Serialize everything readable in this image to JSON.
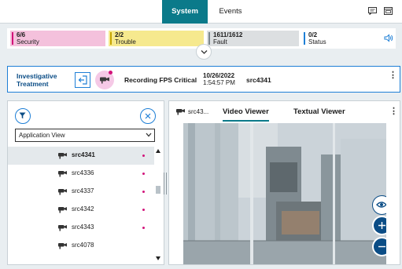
{
  "tabs": [
    {
      "label": "System",
      "active": true
    },
    {
      "label": "Events",
      "active": false
    }
  ],
  "top_icons": [
    "comment-icon",
    "window-icon"
  ],
  "status_cards": [
    {
      "count": "6/6",
      "label": "Security",
      "color": "#f4c1dc",
      "bar_color": "#d2137a"
    },
    {
      "count": "2/2",
      "label": "Trouble",
      "color": "#f6e98e",
      "bar_color": "#c6a500"
    },
    {
      "count": "1611/1612",
      "label": "Fault",
      "color": "#dcdfe1",
      "bar_color": "#7b868c"
    },
    {
      "count": "0/2",
      "label": "Status",
      "color": "#ffffff",
      "bar_color": "#1e7fd6"
    }
  ],
  "alarm": {
    "label": "Investigative Treatment",
    "event": "Recording FPS Critical",
    "date": "10/26/2022",
    "time": "1:54:57 PM",
    "source": "src4341"
  },
  "left_panel": {
    "view_select": "Application View",
    "items": [
      {
        "name": "src4341",
        "selected": true
      },
      {
        "name": "src4336",
        "selected": false
      },
      {
        "name": "src4337",
        "selected": false
      },
      {
        "name": "src4342",
        "selected": false
      },
      {
        "name": "src4343",
        "selected": false
      },
      {
        "name": "src4078",
        "selected": false
      }
    ]
  },
  "right_panel": {
    "source": "src43...",
    "tabs": [
      "Video Viewer",
      "Textual Viewer"
    ],
    "active_tab": "Video Viewer"
  },
  "colors": {
    "accent": "#0b7a8a",
    "link_blue": "#1e7fd6",
    "dark_blue": "#0b4d86",
    "alarm_pink": "#d2137a"
  }
}
